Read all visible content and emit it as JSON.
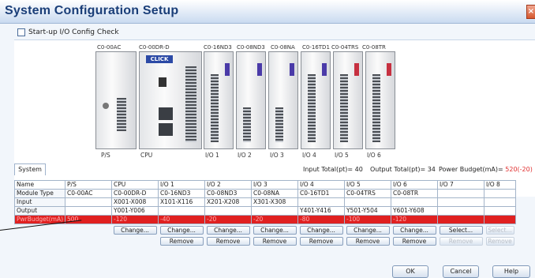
{
  "window": {
    "title": "System Configuration Setup",
    "close_glyph": "×"
  },
  "startup": {
    "label": "Start-up I/O Config Check",
    "checked": false
  },
  "modules": {
    "top_labels": [
      "C0-00AC",
      "C0-00DR-D",
      "C0-16ND3",
      "C0-08ND3",
      "C0-08NA",
      "C0-16TD1",
      "C0-04TRS",
      "C0-08TR"
    ],
    "slot_labels": [
      "P/S",
      "CPU",
      "I/O 1",
      "I/O 2",
      "I/O 3",
      "I/O 4",
      "I/O 5",
      "I/O 6"
    ],
    "cpu_logo": "CLICK"
  },
  "tab": {
    "label": "System"
  },
  "status": {
    "input_total": "Input Total(pt)= 40",
    "output_total": "Output Total(pt)= 34",
    "power_budget_label": "Power Budget(mA)= ",
    "power_budget_value": "520(-20)"
  },
  "table": {
    "headers": [
      "Name",
      "P/S",
      "CPU",
      "I/O 1",
      "I/O 2",
      "I/O 3",
      "I/O 4",
      "I/O 5",
      "I/O 6",
      "I/O 7",
      "I/O 8"
    ],
    "rows": [
      {
        "label": "Module Type",
        "cells": [
          "C0-00AC",
          "C0-00DR-D",
          "C0-16ND3",
          "C0-08ND3",
          "C0-08NA",
          "C0-16TD1",
          "C0-04TRS",
          "C0-08TR",
          "",
          ""
        ]
      },
      {
        "label": "Input",
        "cells": [
          "",
          "X001-X008",
          "X101-X116",
          "X201-X208",
          "X301-X308",
          "",
          "",
          "",
          "",
          ""
        ]
      },
      {
        "label": "Output",
        "cells": [
          "",
          "Y001-Y006",
          "",
          "",
          "",
          "Y401-Y416",
          "Y501-Y504",
          "Y601-Y608",
          "",
          ""
        ]
      },
      {
        "label": "PwrBudget(mA)",
        "cells": [
          "500",
          "-120",
          "-40",
          "-20",
          "-20",
          "-80",
          "-100",
          "-120",
          "",
          ""
        ]
      }
    ],
    "change_label": "Change...",
    "select_label": "Select...",
    "remove_label": "Remove"
  },
  "footer": {
    "ok": "OK",
    "cancel": "Cancel",
    "help": "Help"
  },
  "colors": {
    "warning_row": "#e02020",
    "title_text": "#1a3e78"
  }
}
